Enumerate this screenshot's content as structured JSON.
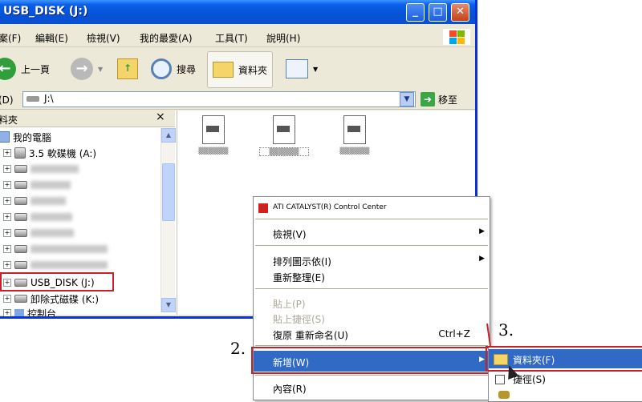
{
  "window": {
    "title": "USB_DISK (J:)",
    "controls": {
      "minimize": "_",
      "maximize": "□",
      "close": "✕"
    }
  },
  "menubar": {
    "items": [
      "案(F)",
      "編輯(E)",
      "檢視(V)",
      "我的最愛(A)",
      "工具(T)",
      "說明(H)"
    ]
  },
  "toolbar": {
    "back": "上一頁",
    "search": "搜尋",
    "folders": "資料夾"
  },
  "address": {
    "label": "止(D)",
    "value": "J:\\",
    "go": "移至"
  },
  "folder_pane": {
    "title": "料夾",
    "close": "×",
    "items": [
      "我的電腦",
      "3.5 軟碟機 (A:)",
      "USB_DISK (J:)",
      "卸除式磁碟 (K:)",
      "控制台"
    ]
  },
  "context_menu": {
    "header": "ATI CATALYST(R) Control Center",
    "items": [
      {
        "label": "檢視(V)"
      },
      {
        "label": "排列圖示依(I)"
      },
      {
        "label": "重新整理(E)"
      },
      {
        "label": "貼上(P)"
      },
      {
        "label": "貼上捷徑(S)"
      },
      {
        "label": "復原 重新命名(U)",
        "shortcut": "Ctrl+Z"
      },
      {
        "label": "新增(W)"
      },
      {
        "label": "內容(R)"
      }
    ]
  },
  "submenu": {
    "items": [
      "資料夾(F)",
      "捷徑(S)"
    ]
  },
  "steps": {
    "two": "2.",
    "three": "3."
  },
  "colors": {
    "highlight": "#316ac5",
    "annotation": "#c8202a"
  }
}
